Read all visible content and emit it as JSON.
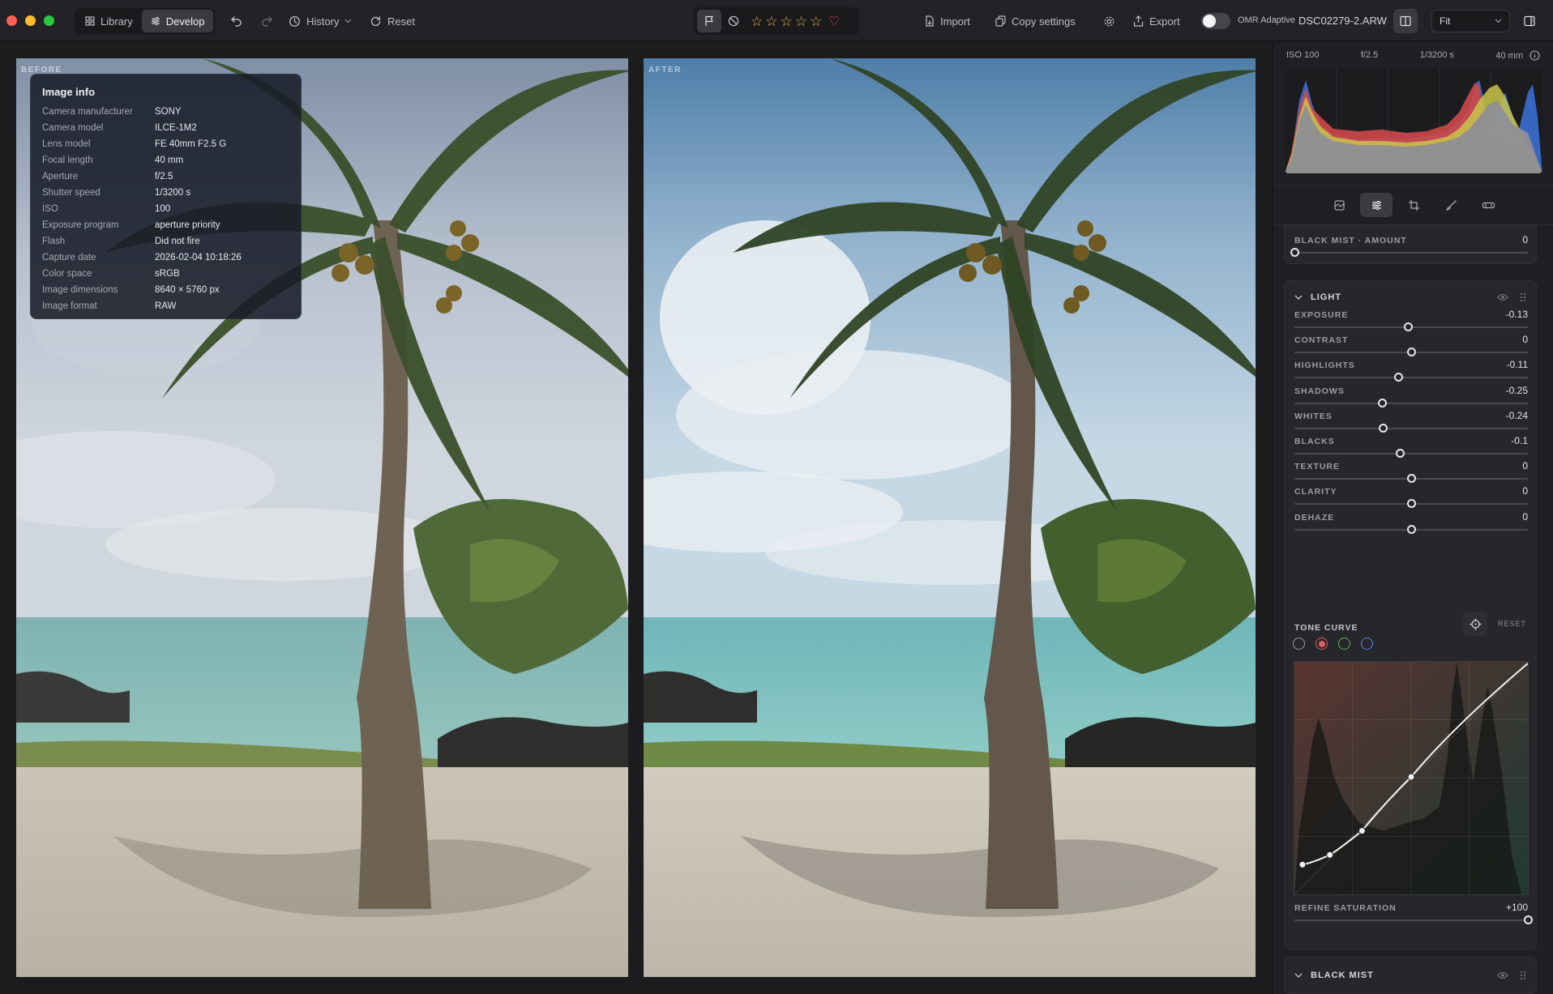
{
  "window": {
    "mode_tabs": [
      {
        "label": "Library",
        "active": false
      },
      {
        "label": "Develop",
        "active": true
      }
    ],
    "history_label": "History",
    "reset_label": "Reset",
    "import_label": "Import",
    "copy_settings_label": "Copy settings",
    "export_label": "Export",
    "omr_label": "OMR Adaptive",
    "filename": "DSC02279-2.ARW",
    "zoom_option": "Fit",
    "rating_stars": 5,
    "colors": {
      "accent_star": "#e8b54a",
      "heart": "#ff5d63"
    }
  },
  "viewer": {
    "before_label": "BEFORE",
    "after_label": "AFTER"
  },
  "image_info": {
    "title": "Image info",
    "rows": [
      {
        "k": "Camera manufacturer",
        "v": "SONY"
      },
      {
        "k": "Camera model",
        "v": "ILCE-1M2"
      },
      {
        "k": "Lens model",
        "v": "FE 40mm F2.5 G"
      },
      {
        "k": "Focal length",
        "v": "40 mm"
      },
      {
        "k": "Aperture",
        "v": "f/2.5"
      },
      {
        "k": "Shutter speed",
        "v": "1/3200 s"
      },
      {
        "k": "ISO",
        "v": "100"
      },
      {
        "k": "Exposure program",
        "v": "aperture priority"
      },
      {
        "k": "Flash",
        "v": "Did not fire"
      },
      {
        "k": "Capture date",
        "v": "2026-02-04 10:18:26"
      },
      {
        "k": "Color space",
        "v": "sRGB"
      },
      {
        "k": "Image dimensions",
        "v": "8640 × 5760 px"
      },
      {
        "k": "Image format",
        "v": "RAW"
      }
    ]
  },
  "sidebar": {
    "meta": {
      "iso": "ISO 100",
      "aperture": "f/2.5",
      "shutter": "1/3200 s",
      "focal": "40 mm"
    },
    "tool_tabs": [
      "presets-icon",
      "adjust-icon",
      "crop-icon",
      "brush-icon",
      "lens-icon"
    ],
    "black_mist_amount": {
      "label": "BLACK MIST · AMOUNT",
      "value": "0",
      "fraction": 0.0
    },
    "light": {
      "title": "LIGHT",
      "sliders": [
        {
          "label": "EXPOSURE",
          "value": "-0.13",
          "fraction": 0.485
        },
        {
          "label": "CONTRAST",
          "value": "0",
          "fraction": 0.5
        },
        {
          "label": "HIGHLIGHTS",
          "value": "-0.11",
          "fraction": 0.445
        },
        {
          "label": "SHADOWS",
          "value": "-0.25",
          "fraction": 0.375
        },
        {
          "label": "WHITES",
          "value": "-0.24",
          "fraction": 0.38
        },
        {
          "label": "BLACKS",
          "value": "-0.1",
          "fraction": 0.45
        },
        {
          "label": "TEXTURE",
          "value": "0",
          "fraction": 0.5
        },
        {
          "label": "CLARITY",
          "value": "0",
          "fraction": 0.5
        },
        {
          "label": "DEHAZE",
          "value": "0",
          "fraction": 0.5
        }
      ],
      "tone_curve_title": "TONE CURVE",
      "tone_curve_reset": "RESET",
      "channels": [
        {
          "name": "luma",
          "color": "#9a9aa2",
          "active": false
        },
        {
          "name": "red",
          "color": "#e25c5c",
          "active": true
        },
        {
          "name": "green",
          "color": "#5fae5f",
          "active": false
        },
        {
          "name": "blue",
          "color": "#5a86e0",
          "active": false
        }
      ],
      "refine_saturation": {
        "label": "REFINE SATURATION",
        "value": "+100",
        "fraction": 1.0
      }
    },
    "black_mist": {
      "title": "BLACK MIST"
    }
  }
}
